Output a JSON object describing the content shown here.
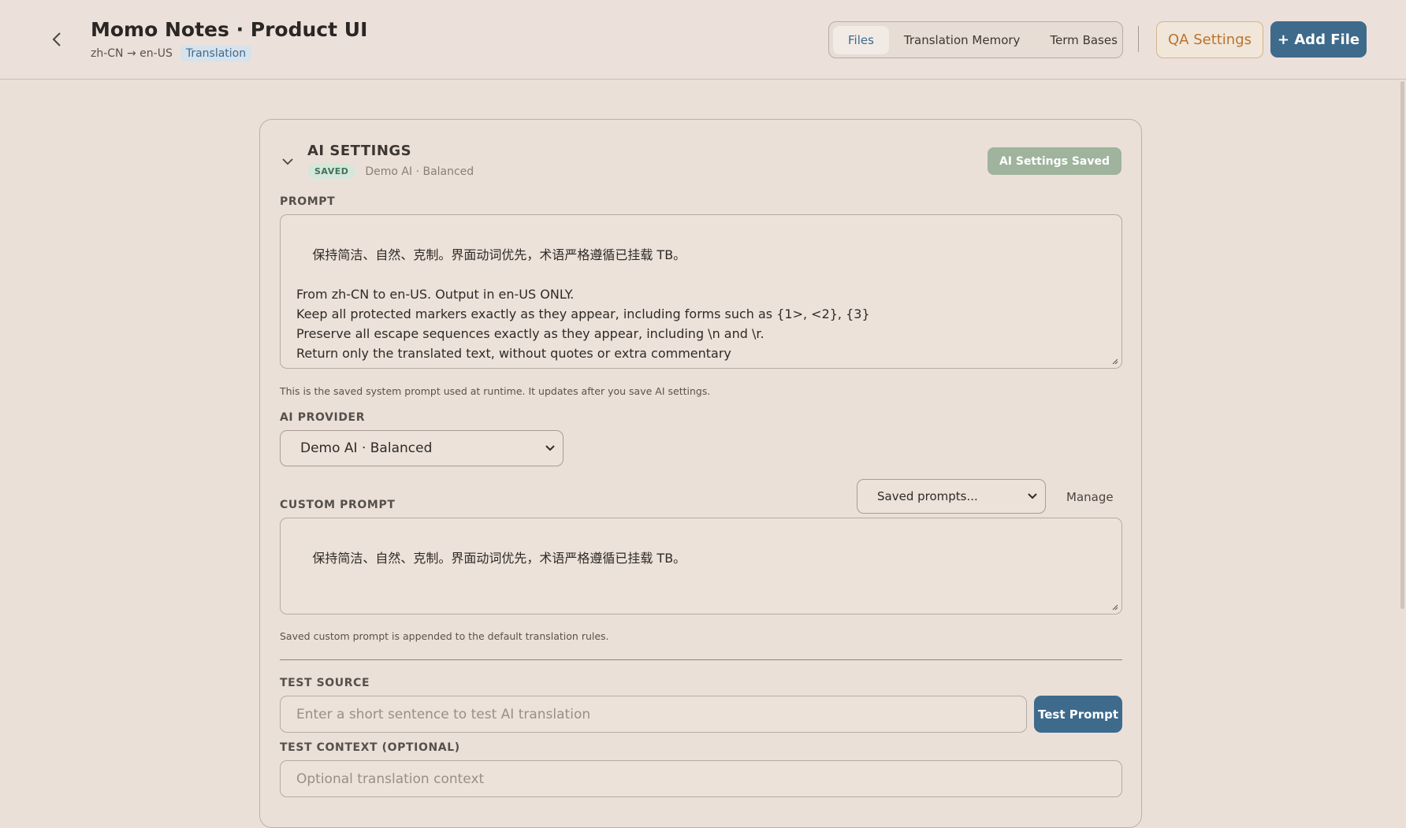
{
  "header": {
    "title": "Momo Notes · Product UI",
    "lang_pair": "zh-CN → en-US",
    "mode": "Translation",
    "back_icon": "chevron-left-icon"
  },
  "nav": {
    "tabs": [
      {
        "label": "Files",
        "active": true
      },
      {
        "label": "Translation Memory",
        "active": false
      },
      {
        "label": "Term Bases",
        "active": false
      }
    ]
  },
  "actions": {
    "qa_settings": "QA Settings",
    "add_file": "+ Add File"
  },
  "ai_settings": {
    "title": "AI SETTINGS",
    "saved_badge": "SAVED",
    "saved_provider": "Demo AI · Balanced",
    "saved_pill": "AI Settings Saved",
    "prompt_label": "PROMPT",
    "prompt_text": "保持简洁、自然、克制。界面动词优先，术语严格遵循已挂载 TB。\n\nFrom zh-CN to en-US. Output in en-US ONLY.\nKeep all protected markers exactly as they appear, including forms such as {1>, <2}, {3}\nPreserve all escape sequences exactly as they appear, including \\n and \\r.\nReturn only the translated text, without quotes or extra commentary",
    "prompt_helper": "This is the saved system prompt used at runtime. It updates after you save AI settings.",
    "provider_label": "AI PROVIDER",
    "provider_value": "Demo AI · Balanced",
    "custom_prompt_label": "CUSTOM PROMPT",
    "saved_prompts_placeholder": "Saved prompts...",
    "manage_label": "Manage",
    "custom_prompt_text": "保持简洁、自然、克制。界面动词优先，术语严格遵循已挂载 TB。",
    "custom_prompt_helper": "Saved custom prompt is appended to the default translation rules.",
    "test_source_label": "TEST SOURCE",
    "test_source_placeholder": "Enter a short sentence to test AI translation",
    "test_prompt_button": "Test Prompt",
    "test_context_label": "TEST CONTEXT (OPTIONAL)",
    "test_context_placeholder": "Optional translation context"
  },
  "colors": {
    "accent": "#3e6a8c",
    "background": "#ebe0d8",
    "qa_text": "#b8742e",
    "saved_green": "#9fb39d"
  }
}
